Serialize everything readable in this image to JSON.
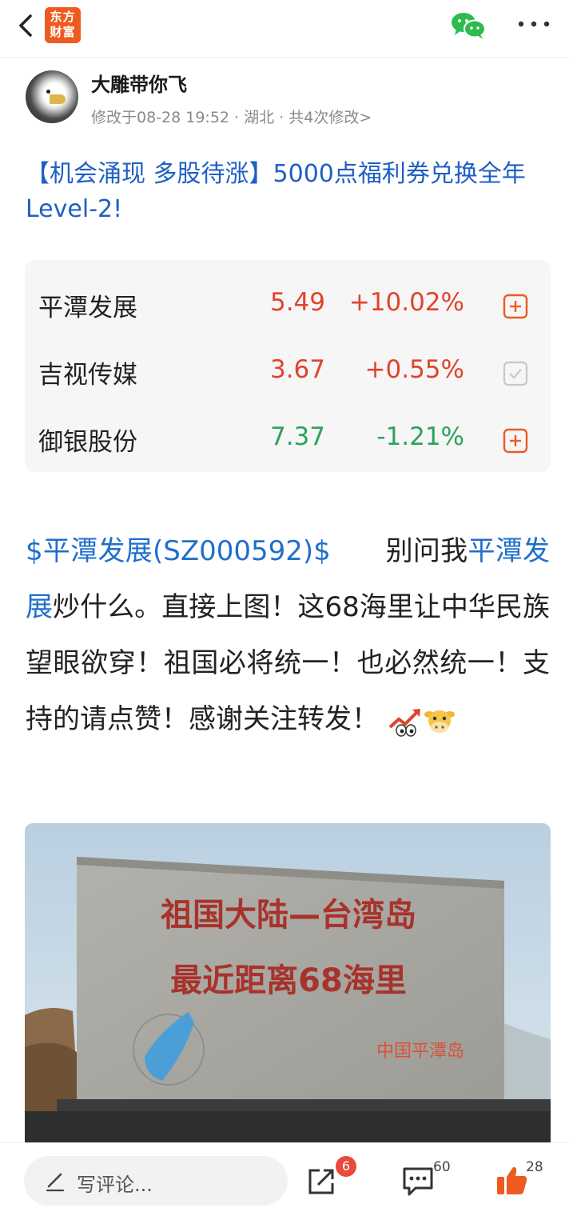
{
  "header": {
    "logo_line1": "东方",
    "logo_line2": "财富",
    "back_icon": "chevron-left-icon",
    "share_icon": "wechat-icon",
    "more_icon": "more-dots-icon"
  },
  "author": {
    "name": "大雕带你飞",
    "meta": "修改于08-28 19:52 · 湖北 · 共4次修改>"
  },
  "post": {
    "title": "【机会涌现 多股待涨】5000点福利券兑换全年Level-2!",
    "body_link1": "$平潭发展(SZ000592)$",
    "body_gap": "　　别问我",
    "body_link2": "平潭发展",
    "body_text": "炒什么。直接上图！这68海里让中华民族望眼欲穿！祖国必将统一！也必然统一！支持的请点赞！感谢关注转发！"
  },
  "stocks": [
    {
      "name": "平潭发展",
      "price": "5.49",
      "change": "+10.02%",
      "trend": "up",
      "action": "add-icon"
    },
    {
      "name": "吉视传媒",
      "price": "3.67",
      "change": "+0.55%",
      "trend": "up",
      "action": "checked-icon"
    },
    {
      "name": "御银股份",
      "price": "7.37",
      "change": "-1.21%",
      "trend": "down",
      "action": "add-icon"
    }
  ],
  "photo": {
    "line1": "祖国大陆—台湾岛",
    "line2": "最近距离68海里",
    "watermark": "中国平潭岛"
  },
  "bottom": {
    "comment_placeholder": "写评论...",
    "share_count": "6",
    "comment_count": "60",
    "like_count": "28"
  },
  "colors": {
    "brand": "#ee5b21",
    "link": "#1f6fcc",
    "up": "#e0442a",
    "down": "#2aa45a"
  }
}
